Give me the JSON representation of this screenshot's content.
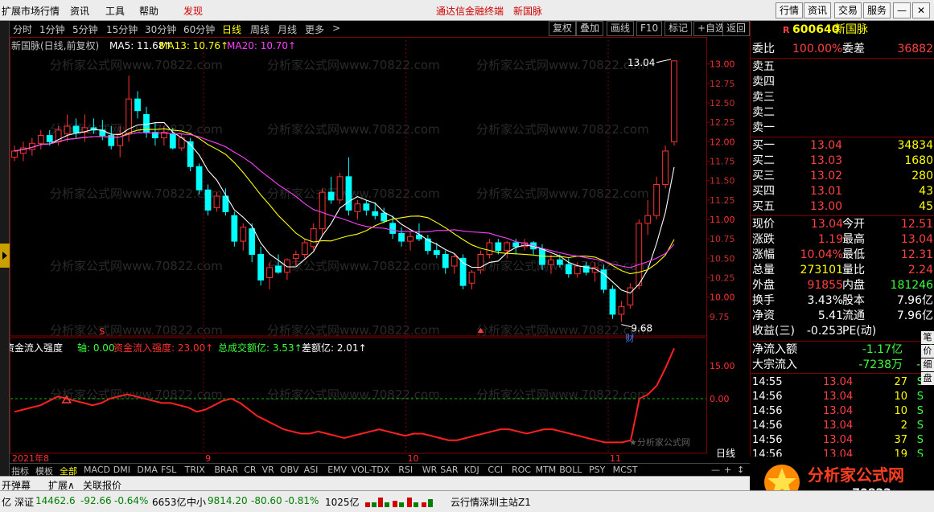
{
  "menu": {
    "items": [
      "扩展市场行情",
      "资讯",
      "工具",
      "帮助"
    ],
    "discover": "发现",
    "center_title": "通达信金融终端",
    "center_stock": "新国脉",
    "right_buttons": [
      "行情",
      "资讯",
      "交易",
      "服务"
    ],
    "window_buttons": [
      "—",
      "▭",
      "✕"
    ]
  },
  "periods": [
    "分时",
    "1分钟",
    "5分钟",
    "15分钟",
    "30分钟",
    "60分钟",
    "日线",
    "周线",
    "月线",
    "更多",
    ">"
  ],
  "active_period": "日线",
  "toolbar_buttons": [
    "复权",
    "叠加",
    "画线",
    "F10",
    "标记",
    "+自选",
    "返回"
  ],
  "chart_header": {
    "name": "新国脉(日线,前复权)",
    "ma5": "MA5: 11.68↑",
    "ma13": "MA13: 10.76↑",
    "ma20": "MA20: 10.70↑"
  },
  "indicator_header": {
    "name": "资金流入强度",
    "axis": "轴: 0.00",
    "strength": "资金流入强度: 23.00↑",
    "vol": "总成交额亿: 3.53↑",
    "diff": "差额亿: 2.01↑"
  },
  "chart_data": [
    {
      "type": "candlestick",
      "title": "新国脉(日线,前复权)",
      "ylim": [
        9.5,
        13.1
      ],
      "yticks": [
        "13.00",
        "12.75",
        "12.50",
        "12.25",
        "12.00",
        "11.75",
        "11.50",
        "11.25",
        "11.00",
        "10.75",
        "10.50",
        "10.25",
        "10.00",
        "9.75"
      ],
      "xlabels": [
        "2021年8",
        "9",
        "10",
        "11"
      ],
      "annotations": {
        "high_label": "13.04",
        "low_label": "9.68",
        "marker": "财"
      },
      "candles": [
        [
          11.8,
          11.95,
          11.75,
          11.88
        ],
        [
          11.85,
          12.0,
          11.75,
          11.92
        ],
        [
          11.9,
          12.05,
          11.82,
          11.98
        ],
        [
          11.98,
          12.15,
          11.9,
          12.08
        ],
        [
          12.08,
          12.15,
          11.95,
          12.0
        ],
        [
          12.0,
          12.2,
          11.95,
          12.15
        ],
        [
          12.1,
          12.35,
          12.0,
          12.2
        ],
        [
          12.2,
          12.3,
          12.05,
          12.12
        ],
        [
          12.12,
          12.35,
          12.0,
          12.18
        ],
        [
          12.18,
          12.3,
          12.1,
          12.15
        ],
        [
          12.15,
          12.28,
          12.02,
          12.08
        ],
        [
          12.08,
          12.2,
          11.9,
          11.95
        ],
        [
          11.95,
          12.2,
          11.8,
          12.1
        ],
        [
          12.1,
          12.85,
          12.0,
          12.55
        ],
        [
          12.55,
          12.65,
          12.3,
          12.4
        ],
        [
          12.35,
          12.45,
          12.05,
          12.12
        ],
        [
          12.12,
          12.25,
          11.95,
          12.05
        ],
        [
          12.05,
          12.2,
          11.95,
          12.12
        ],
        [
          12.1,
          12.18,
          11.9,
          11.92
        ],
        [
          11.92,
          12.1,
          11.88,
          12.05
        ],
        [
          12.0,
          12.05,
          11.62,
          11.68
        ],
        [
          11.68,
          11.72,
          11.32,
          11.38
        ],
        [
          11.38,
          11.45,
          11.05,
          11.12
        ],
        [
          11.15,
          11.35,
          11.1,
          11.3
        ],
        [
          11.3,
          11.4,
          11.05,
          11.1
        ],
        [
          11.05,
          11.1,
          10.65,
          10.72
        ],
        [
          10.72,
          10.95,
          10.6,
          10.9
        ],
        [
          10.88,
          10.95,
          10.45,
          10.55
        ],
        [
          10.55,
          10.65,
          10.15,
          10.22
        ],
        [
          10.25,
          10.45,
          10.1,
          10.38
        ],
        [
          10.4,
          10.55,
          10.3,
          10.32
        ],
        [
          10.32,
          10.5,
          10.22,
          10.48
        ],
        [
          10.5,
          10.6,
          10.4,
          10.55
        ],
        [
          10.55,
          10.75,
          10.5,
          10.7
        ],
        [
          10.65,
          10.95,
          10.6,
          10.88
        ],
        [
          10.88,
          11.4,
          10.8,
          11.35
        ],
        [
          11.35,
          11.55,
          11.2,
          11.25
        ],
        [
          11.25,
          11.6,
          11.2,
          11.55
        ],
        [
          11.55,
          11.8,
          11.05,
          11.12
        ],
        [
          11.1,
          11.25,
          11.0,
          11.2
        ],
        [
          11.2,
          11.25,
          11.05,
          11.12
        ],
        [
          11.1,
          11.22,
          11.0,
          11.05
        ],
        [
          11.08,
          11.15,
          10.95,
          10.98
        ],
        [
          10.95,
          11.05,
          10.75,
          10.82
        ],
        [
          10.82,
          10.9,
          10.65,
          10.72
        ],
        [
          10.72,
          10.85,
          10.6,
          10.78
        ],
        [
          10.8,
          10.95,
          10.72,
          10.75
        ],
        [
          10.75,
          10.8,
          10.55,
          10.6
        ],
        [
          10.6,
          10.7,
          10.5,
          10.55
        ],
        [
          10.55,
          10.6,
          10.3,
          10.38
        ],
        [
          10.4,
          10.55,
          10.3,
          10.52
        ],
        [
          10.5,
          10.55,
          10.1,
          10.15
        ],
        [
          10.18,
          10.35,
          10.1,
          10.32
        ],
        [
          10.35,
          10.6,
          10.3,
          10.55
        ],
        [
          10.55,
          10.75,
          10.5,
          10.7
        ],
        [
          10.7,
          10.75,
          10.55,
          10.6
        ],
        [
          10.6,
          10.72,
          10.5,
          10.7
        ],
        [
          10.7,
          10.75,
          10.55,
          10.65
        ],
        [
          10.65,
          10.75,
          10.6,
          10.7
        ],
        [
          10.7,
          10.72,
          10.55,
          10.62
        ],
        [
          10.62,
          10.68,
          10.35,
          10.42
        ],
        [
          10.42,
          10.55,
          10.3,
          10.48
        ],
        [
          10.48,
          10.55,
          10.38,
          10.42
        ],
        [
          10.42,
          10.5,
          10.25,
          10.3
        ],
        [
          10.3,
          10.45,
          10.25,
          10.4
        ],
        [
          10.4,
          10.45,
          10.28,
          10.32
        ],
        [
          10.32,
          10.45,
          10.2,
          10.38
        ],
        [
          10.35,
          10.42,
          10.05,
          10.1
        ],
        [
          10.1,
          10.15,
          9.72,
          9.78
        ],
        [
          9.78,
          9.95,
          9.68,
          9.88
        ],
        [
          9.9,
          10.18,
          9.85,
          10.12
        ],
        [
          10.15,
          11.0,
          10.1,
          10.95
        ],
        [
          10.95,
          11.25,
          10.8,
          11.05
        ],
        [
          11.05,
          11.55,
          11.0,
          11.45
        ],
        [
          11.45,
          11.95,
          11.4,
          11.88
        ],
        [
          12.0,
          13.04,
          11.95,
          13.04
        ]
      ]
    },
    {
      "type": "line",
      "title": "资金流入强度",
      "ylim": [
        -25,
        25
      ],
      "yticks": [
        "15.00",
        "0.00"
      ],
      "series": [
        {
          "name": "资金流入强度",
          "values": [
            -6,
            -5,
            -4,
            -3,
            -1,
            1,
            0,
            -1,
            -2,
            -3,
            -2,
            0,
            1,
            2,
            1,
            0,
            -1,
            -2,
            -2,
            -3,
            -4,
            -6,
            -5,
            -3,
            -1,
            0,
            -2,
            -5,
            -8,
            -10,
            -12,
            -14,
            -15,
            -16,
            -16,
            -15,
            -16,
            -17,
            -18,
            -17,
            -16,
            -15,
            -14,
            -15,
            -16,
            -17,
            -16,
            -16,
            -17,
            -18,
            -19,
            -19,
            -18,
            -17,
            -16,
            -15,
            -14,
            -14,
            -15,
            -16,
            -15,
            -14,
            -14,
            -15,
            -16,
            -17,
            -18,
            -19,
            -20,
            -20,
            -20,
            -19,
            0,
            2,
            6,
            14,
            23
          ]
        }
      ]
    }
  ],
  "watermark": "分析家公式网www.70822.com",
  "watermark2": "★分析家公式网",
  "tick_flag": "日线",
  "quote": {
    "r_badge": "R",
    "code": "600640",
    "name": "新国脉",
    "weibi_label": "委比",
    "weibi": "100.00%",
    "weicha_label": "委差",
    "weicha": "36882",
    "sells": [
      "卖五",
      "卖四",
      "卖三",
      "卖二",
      "卖一"
    ],
    "buys": [
      {
        "label": "买一",
        "price": "13.04",
        "vol": "34834"
      },
      {
        "label": "买二",
        "price": "13.03",
        "vol": "1680"
      },
      {
        "label": "买三",
        "price": "13.02",
        "vol": "280"
      },
      {
        "label": "买四",
        "price": "13.01",
        "vol": "43"
      },
      {
        "label": "买五",
        "price": "13.00",
        "vol": "45"
      }
    ],
    "stats": [
      {
        "l1": "现价",
        "v1": "13.04",
        "l2": "今开",
        "v2": "12.51"
      },
      {
        "l1": "涨跌",
        "v1": "1.19",
        "l2": "最高",
        "v2": "13.04"
      },
      {
        "l1": "涨幅",
        "v1": "10.04%",
        "l2": "最低",
        "v2": "12.31"
      },
      {
        "l1": "总量",
        "v1": "273101",
        "l2": "量比",
        "v2": "2.24"
      },
      {
        "l1": "外盘",
        "v1": "91855",
        "l2": "内盘",
        "v2": "181246"
      },
      {
        "l1": "换手",
        "v1": "3.43%",
        "l2": "股本",
        "v2": "7.96亿"
      },
      {
        "l1": "净资",
        "v1": "5.41",
        "l2": "流通",
        "v2": "7.96亿"
      },
      {
        "l1": "收益(三)",
        "v1": "-0.253",
        "l2": "PE(动)",
        "v2": ""
      }
    ],
    "flow": [
      {
        "label": "净流入额",
        "v1": "-1.17亿",
        "v2": "-3"
      },
      {
        "label": "大宗流入",
        "v1": "-7238万",
        "v2": "-20"
      }
    ],
    "side_tabs": [
      "笔",
      "价",
      "细",
      "盘"
    ],
    "ticks": [
      {
        "time": "14:55",
        "price": "13.04",
        "vol": "27",
        "dir": "S"
      },
      {
        "time": "14:56",
        "price": "13.04",
        "vol": "10",
        "dir": "S"
      },
      {
        "time": "14:56",
        "price": "13.04",
        "vol": "10",
        "dir": "S"
      },
      {
        "time": "14:56",
        "price": "13.04",
        "vol": "2",
        "dir": "S"
      },
      {
        "time": "14:56",
        "price": "13.04",
        "vol": "37",
        "dir": "S"
      },
      {
        "time": "14:56",
        "price": "13.04",
        "vol": "19",
        "dir": "S"
      },
      {
        "time": "15",
        "price": "",
        "vol": "",
        "dir": ""
      }
    ]
  },
  "indicator_tabs": [
    "指标",
    "模板",
    "全部",
    "MACD",
    "DMI",
    "DMA",
    "FSL",
    "TRIX",
    "BRAR",
    "CR",
    "VR",
    "OBV",
    "ASI",
    "EMV",
    "VOL-TDX",
    "RSI",
    "WR",
    "SAR",
    "KDJ",
    "CCI",
    "ROC",
    "MTM",
    "BOLL",
    "PSY",
    "MCST"
  ],
  "indicator_tabs_active": "全部",
  "zoom_buttons": [
    "—",
    "+",
    "↕"
  ],
  "bottom_row": [
    "开弹幕",
    "扩展∧",
    "关联报价"
  ],
  "status": {
    "prefix": "亿",
    "sz_label": "深证",
    "sz_val": "14462.6",
    "sz_chg": "-92.66",
    "sz_pct": "-0.64%",
    "sz_amt": "6653亿",
    "zx_label": "中小",
    "zx_val": "9814.20",
    "zx_chg": "-80.60",
    "zx_pct": "-0.81%",
    "zx_amt": "1025亿",
    "server": "云行情深圳主站Z1"
  },
  "brand": {
    "name": "分析家公式网",
    "url": "www.70822.com"
  }
}
